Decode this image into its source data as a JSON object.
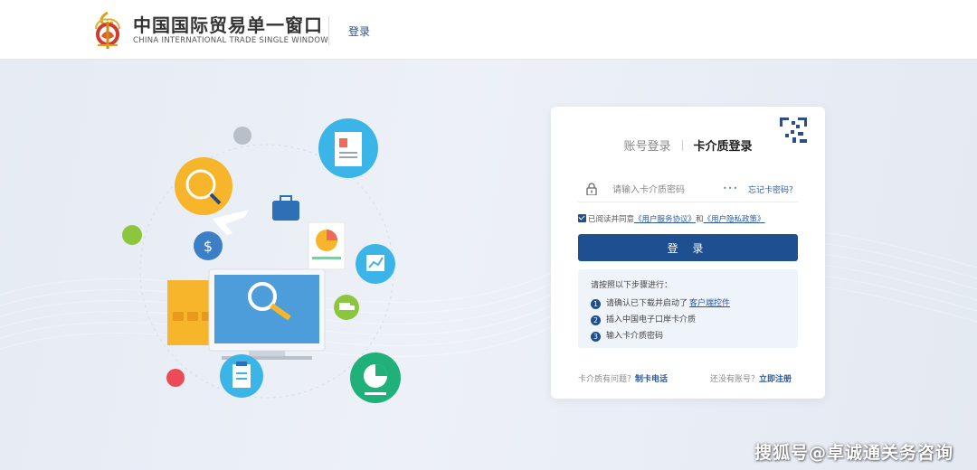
{
  "header": {
    "brand_cn": "中国国际贸易单一窗口",
    "brand_en": "CHINA INTERNATIONAL TRADE SINGLE WINDOW",
    "login_link": "登录"
  },
  "login_card": {
    "tabs": [
      {
        "label": "账号登录",
        "active": false
      },
      {
        "label": "卡介质登录",
        "active": true
      }
    ],
    "password": {
      "placeholder": "请输入卡介质密码",
      "value": "",
      "toggle_icon": "eye-dots-icon"
    },
    "forgot_link": "忘记卡密码？",
    "agreement": {
      "prefix": "已阅读并同意",
      "link1": "《用户服务协议》",
      "middle": "和",
      "link2": "《用户隐私政策》",
      "checked": true
    },
    "submit_label": "登 录",
    "instructions": {
      "title": "请按照以下步骤进行：",
      "steps": [
        {
          "num": "1",
          "text": "请确认已下载并启动了",
          "link": "客户端控件"
        },
        {
          "num": "2",
          "text": "插入中国电子口岸卡介质",
          "link": ""
        },
        {
          "num": "3",
          "text": "输入卡介质密码",
          "link": ""
        }
      ]
    },
    "footer": {
      "left_text": "卡介质有问题？",
      "left_link": "制卡电话",
      "right_text": "还没有账号？",
      "right_link": "立即注册"
    }
  },
  "watermark": "搜狐号@卓诚通关务咨询",
  "colors": {
    "primary": "#1d4f91",
    "link": "#2b5aa3",
    "page_bg": "#e9edf5"
  }
}
